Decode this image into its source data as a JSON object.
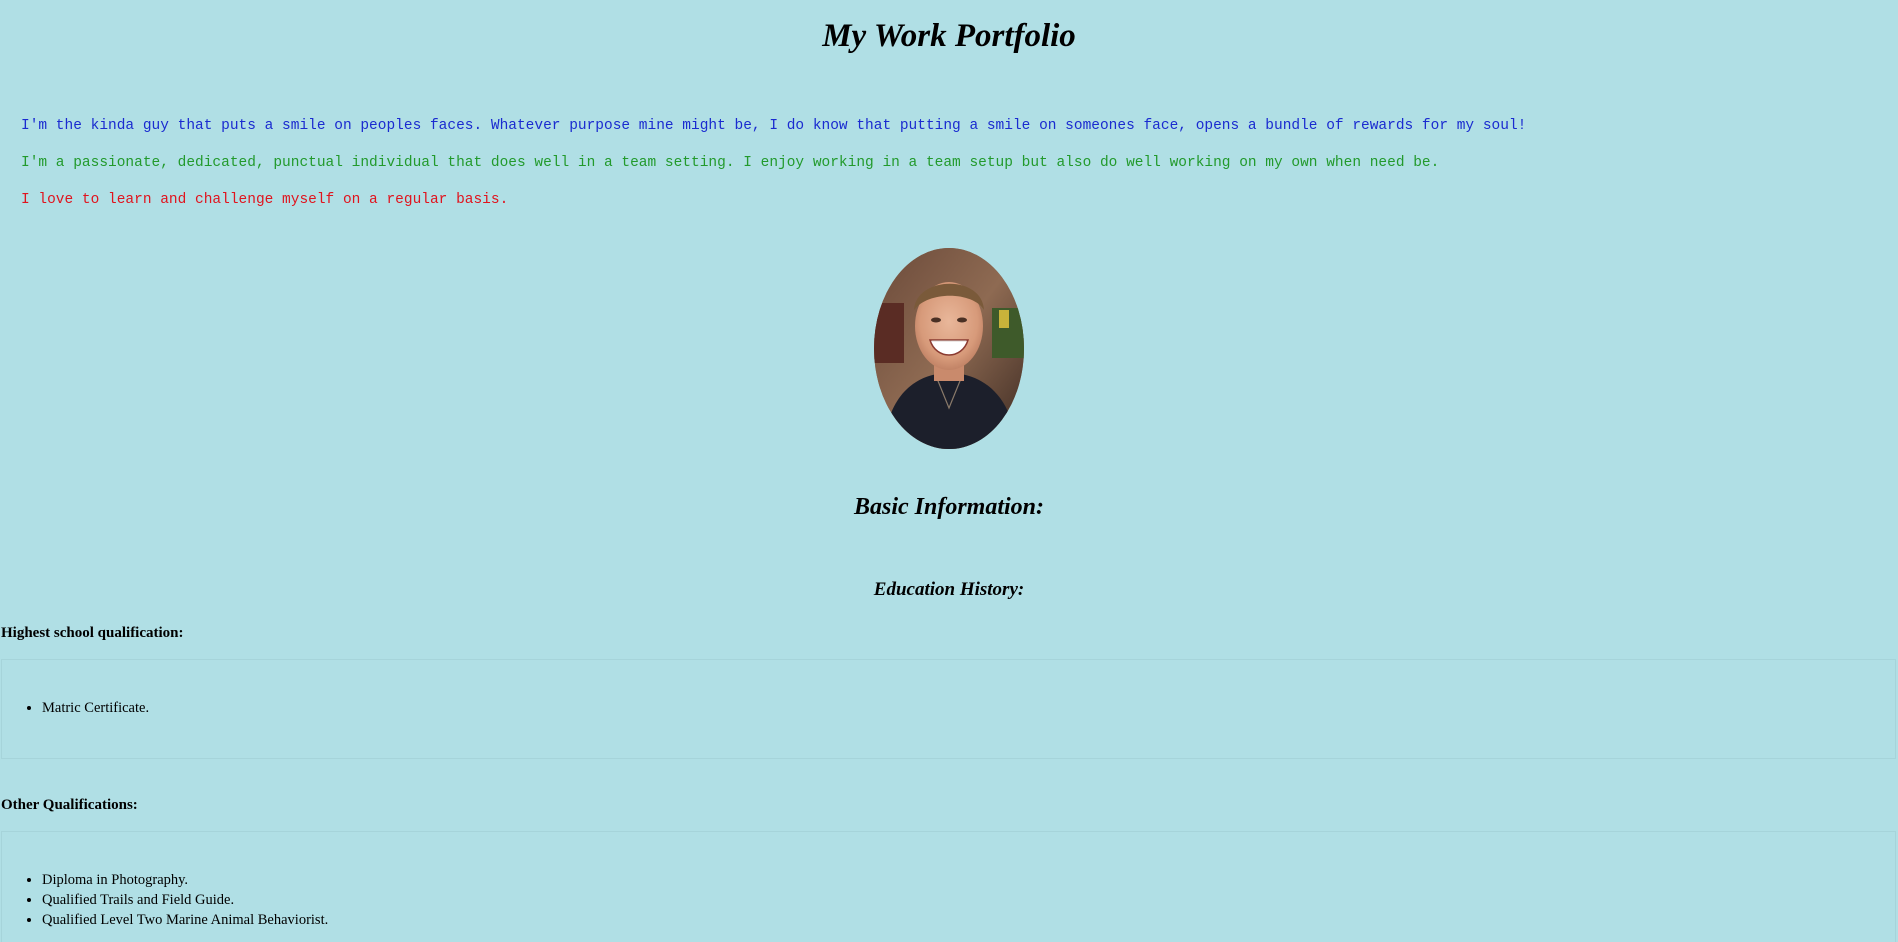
{
  "page": {
    "title": "My Work Portfolio",
    "intro": {
      "line1": "I'm the kinda guy that puts a smile on peoples faces. Whatever purpose mine might be, I do know that putting a smile on someones face, opens a bundle of rewards for my soul!",
      "line2": "I'm a passionate, dedicated, punctual individual that does well in a team setting. I enjoy working in a team setup but also do well working on my own when need be.",
      "line3": "I love to learn and challenge myself on a regular basis."
    },
    "colors": {
      "background": "#b0dfe5",
      "line1": "#1a2bd0",
      "line2": "#229a2c",
      "line3": "#e0141e"
    },
    "photo": {
      "icon": "profile-photo"
    },
    "basic_info_heading": "Basic Information:",
    "education_heading": "Education History:",
    "highest": {
      "label": "Highest school qualification:",
      "items": [
        "Matric Certificate."
      ]
    },
    "other": {
      "label": "Other Qualifications:",
      "items": [
        "Diploma in Photography.",
        "Qualified Trails and Field Guide.",
        "Qualified Level Two Marine Animal Behaviorist."
      ]
    }
  }
}
